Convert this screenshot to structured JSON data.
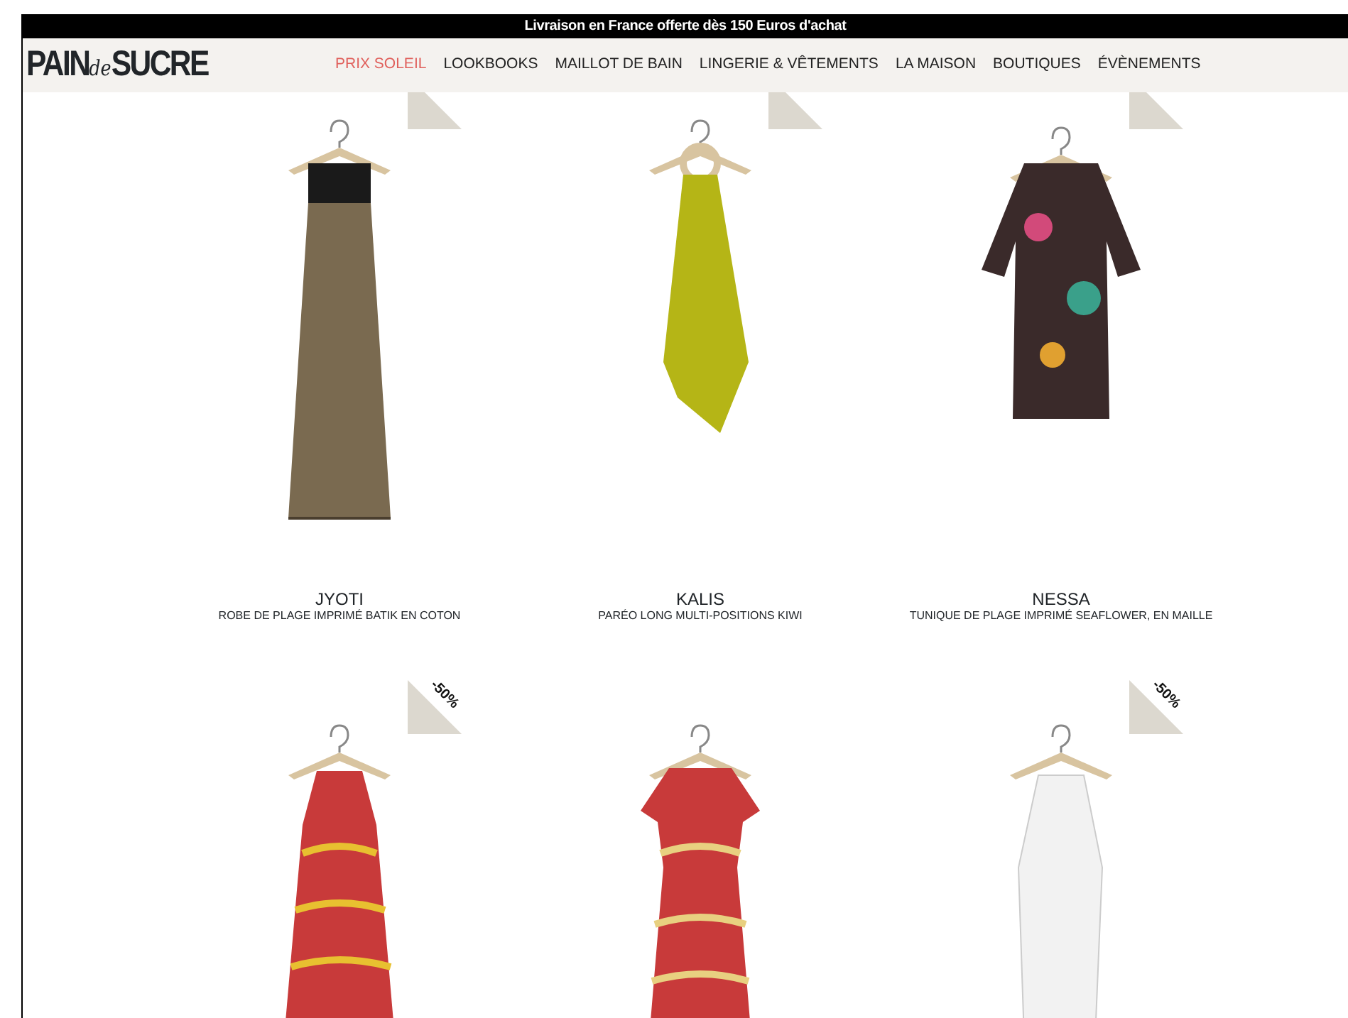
{
  "announcement": "Livraison en France offerte dès 150 Euros d'achat",
  "logo": {
    "before": "PAIN",
    "script": "de",
    "after": "SUCRE"
  },
  "nav": [
    {
      "label": "PRIX SOLEIL",
      "selected": true
    },
    {
      "label": "LOOKBOOKS",
      "selected": false
    },
    {
      "label": "MAILLOT DE BAIN",
      "selected": false
    },
    {
      "label": "LINGERIE & VÊTEMENTS",
      "selected": false
    },
    {
      "label": "LA MAISON",
      "selected": false
    },
    {
      "label": "BOUTIQUES",
      "selected": false
    },
    {
      "label": "ÉVÈNEMENTS",
      "selected": false
    }
  ],
  "products": [
    {
      "kind": "dress",
      "corner": true,
      "name": "JYOTI",
      "description": "ROBE DE PLAGE IMPRIMÉ BATIK EN COTON"
    },
    {
      "kind": "scarf",
      "corner": true,
      "name": "KALIS",
      "description": "PARÉO LONG MULTI-POSITIONS KIWI"
    },
    {
      "kind": "top",
      "corner": true,
      "name": "NESSA",
      "description": "TUNIQUE DE PLAGE IMPRIMÉ SEAFLOWER, EN MAILLE"
    },
    {
      "kind": "halter",
      "corner": true,
      "discount": "-50%"
    },
    {
      "kind": "sundress"
    },
    {
      "kind": "veil",
      "corner": true,
      "discount": "-50%"
    }
  ]
}
